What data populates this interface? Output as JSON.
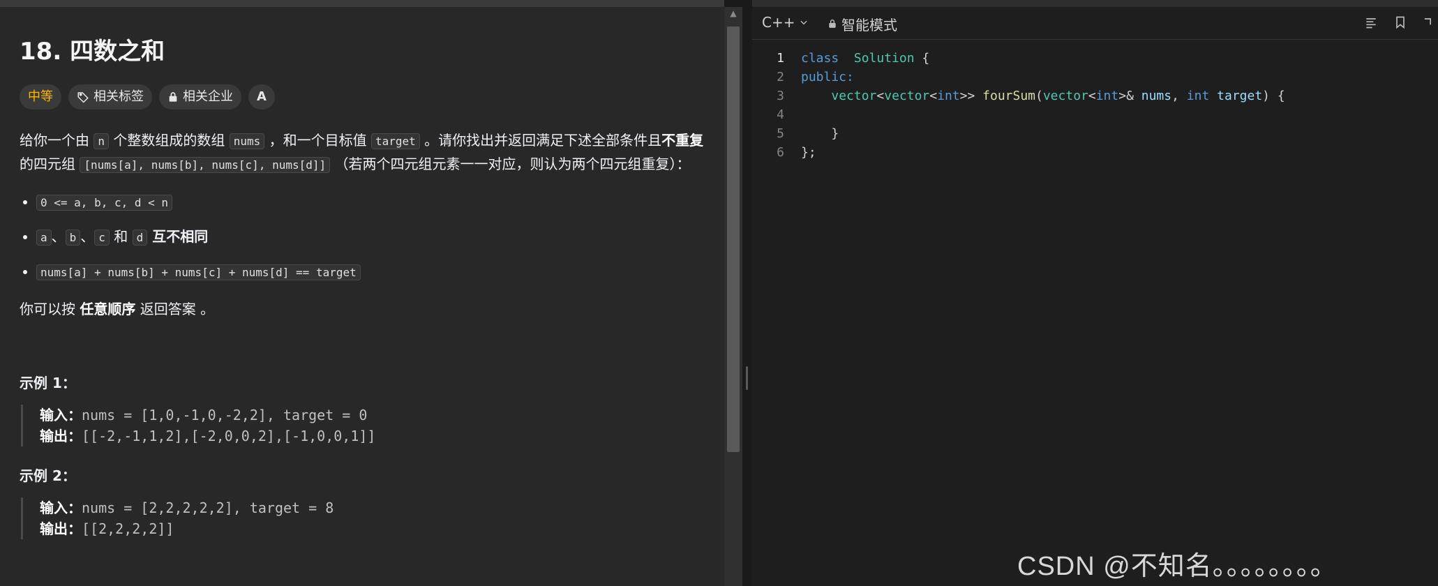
{
  "problem": {
    "title": "18. 四数之和",
    "tags": {
      "difficulty": "中等",
      "related_tags": "相关标签",
      "related_companies": "相关企业",
      "translate": "A"
    },
    "desc": {
      "p1_a": "给你一个由 ",
      "p1_n": "n",
      "p1_b": " 个整数组成的数组 ",
      "p1_nums": "nums",
      "p1_c": " ，和一个目标值 ",
      "p1_target": "target",
      "p1_d": " 。请你找出并返回满足下述全部条件且",
      "p1_bold": "不重复",
      "p1_e": "的四元组 ",
      "p1_tuple": "[nums[a], nums[b], nums[c], nums[d]]",
      "p1_f": " （若两个四元组元素一一对应，则认为两个四元组重复）："
    },
    "conditions": {
      "c1": "0 <= a, b, c, d < n",
      "c2_a": "a",
      "c2_sep1": "、",
      "c2_b": "b",
      "c2_sep2": "、",
      "c2_c": "c",
      "c2_and": " 和 ",
      "c2_d": "d",
      "c2_bold": " 互不相同",
      "c3": "nums[a] + nums[b] + nums[c] + nums[d] == target"
    },
    "note": {
      "a": "你可以按 ",
      "bold": "任意顺序",
      "b": " 返回答案 。"
    },
    "examples": [
      {
        "title": "示例 1：",
        "input_label": "输入：",
        "input": "nums = [1,0,-1,0,-2,2], target = 0",
        "output_label": "输出：",
        "output": "[[-2,-1,1,2],[-2,0,0,2],[-1,0,0,1]]"
      },
      {
        "title": "示例 2：",
        "input_label": "输入：",
        "input": "nums = [2,2,2,2,2], target = 8",
        "output_label": "输出：",
        "output": "[[2,2,2,2]]"
      }
    ]
  },
  "editor": {
    "language": "C++",
    "mode": "智能模式",
    "lines": [
      {
        "num": "1",
        "t": [
          [
            "kw",
            "class"
          ],
          [
            "",
            "  "
          ],
          [
            "type",
            "Solution"
          ],
          [
            "",
            " {"
          ]
        ]
      },
      {
        "num": "2",
        "t": [
          [
            "kw",
            "public:"
          ]
        ]
      },
      {
        "num": "3",
        "t": [
          [
            "",
            "    "
          ],
          [
            "type",
            "vector"
          ],
          [
            "",
            "<"
          ],
          [
            "type",
            "vector"
          ],
          [
            "",
            "<"
          ],
          [
            "kw",
            "int"
          ],
          [
            "",
            ">> "
          ],
          [
            "fn",
            "fourSum"
          ],
          [
            "",
            "("
          ],
          [
            "type",
            "vector"
          ],
          [
            "",
            "<"
          ],
          [
            "kw",
            "int"
          ],
          [
            "",
            ">& "
          ],
          [
            "var",
            "nums"
          ],
          [
            "",
            ", "
          ],
          [
            "kw",
            "int"
          ],
          [
            "var",
            " target"
          ],
          [
            "",
            ") {"
          ]
        ]
      },
      {
        "num": "4",
        "t": [
          [
            "",
            ""
          ]
        ]
      },
      {
        "num": "5",
        "t": [
          [
            "",
            "    }"
          ]
        ]
      },
      {
        "num": "6",
        "t": [
          [
            "",
            "};"
          ]
        ]
      }
    ]
  },
  "watermark": "CSDN @不知名。。。。。。。。",
  "colors": {
    "difficulty": "#ffb800",
    "keyword": "#569cd6",
    "type": "#4ec9b0",
    "function": "#dcdcaa",
    "variable": "#9cdcfe"
  }
}
